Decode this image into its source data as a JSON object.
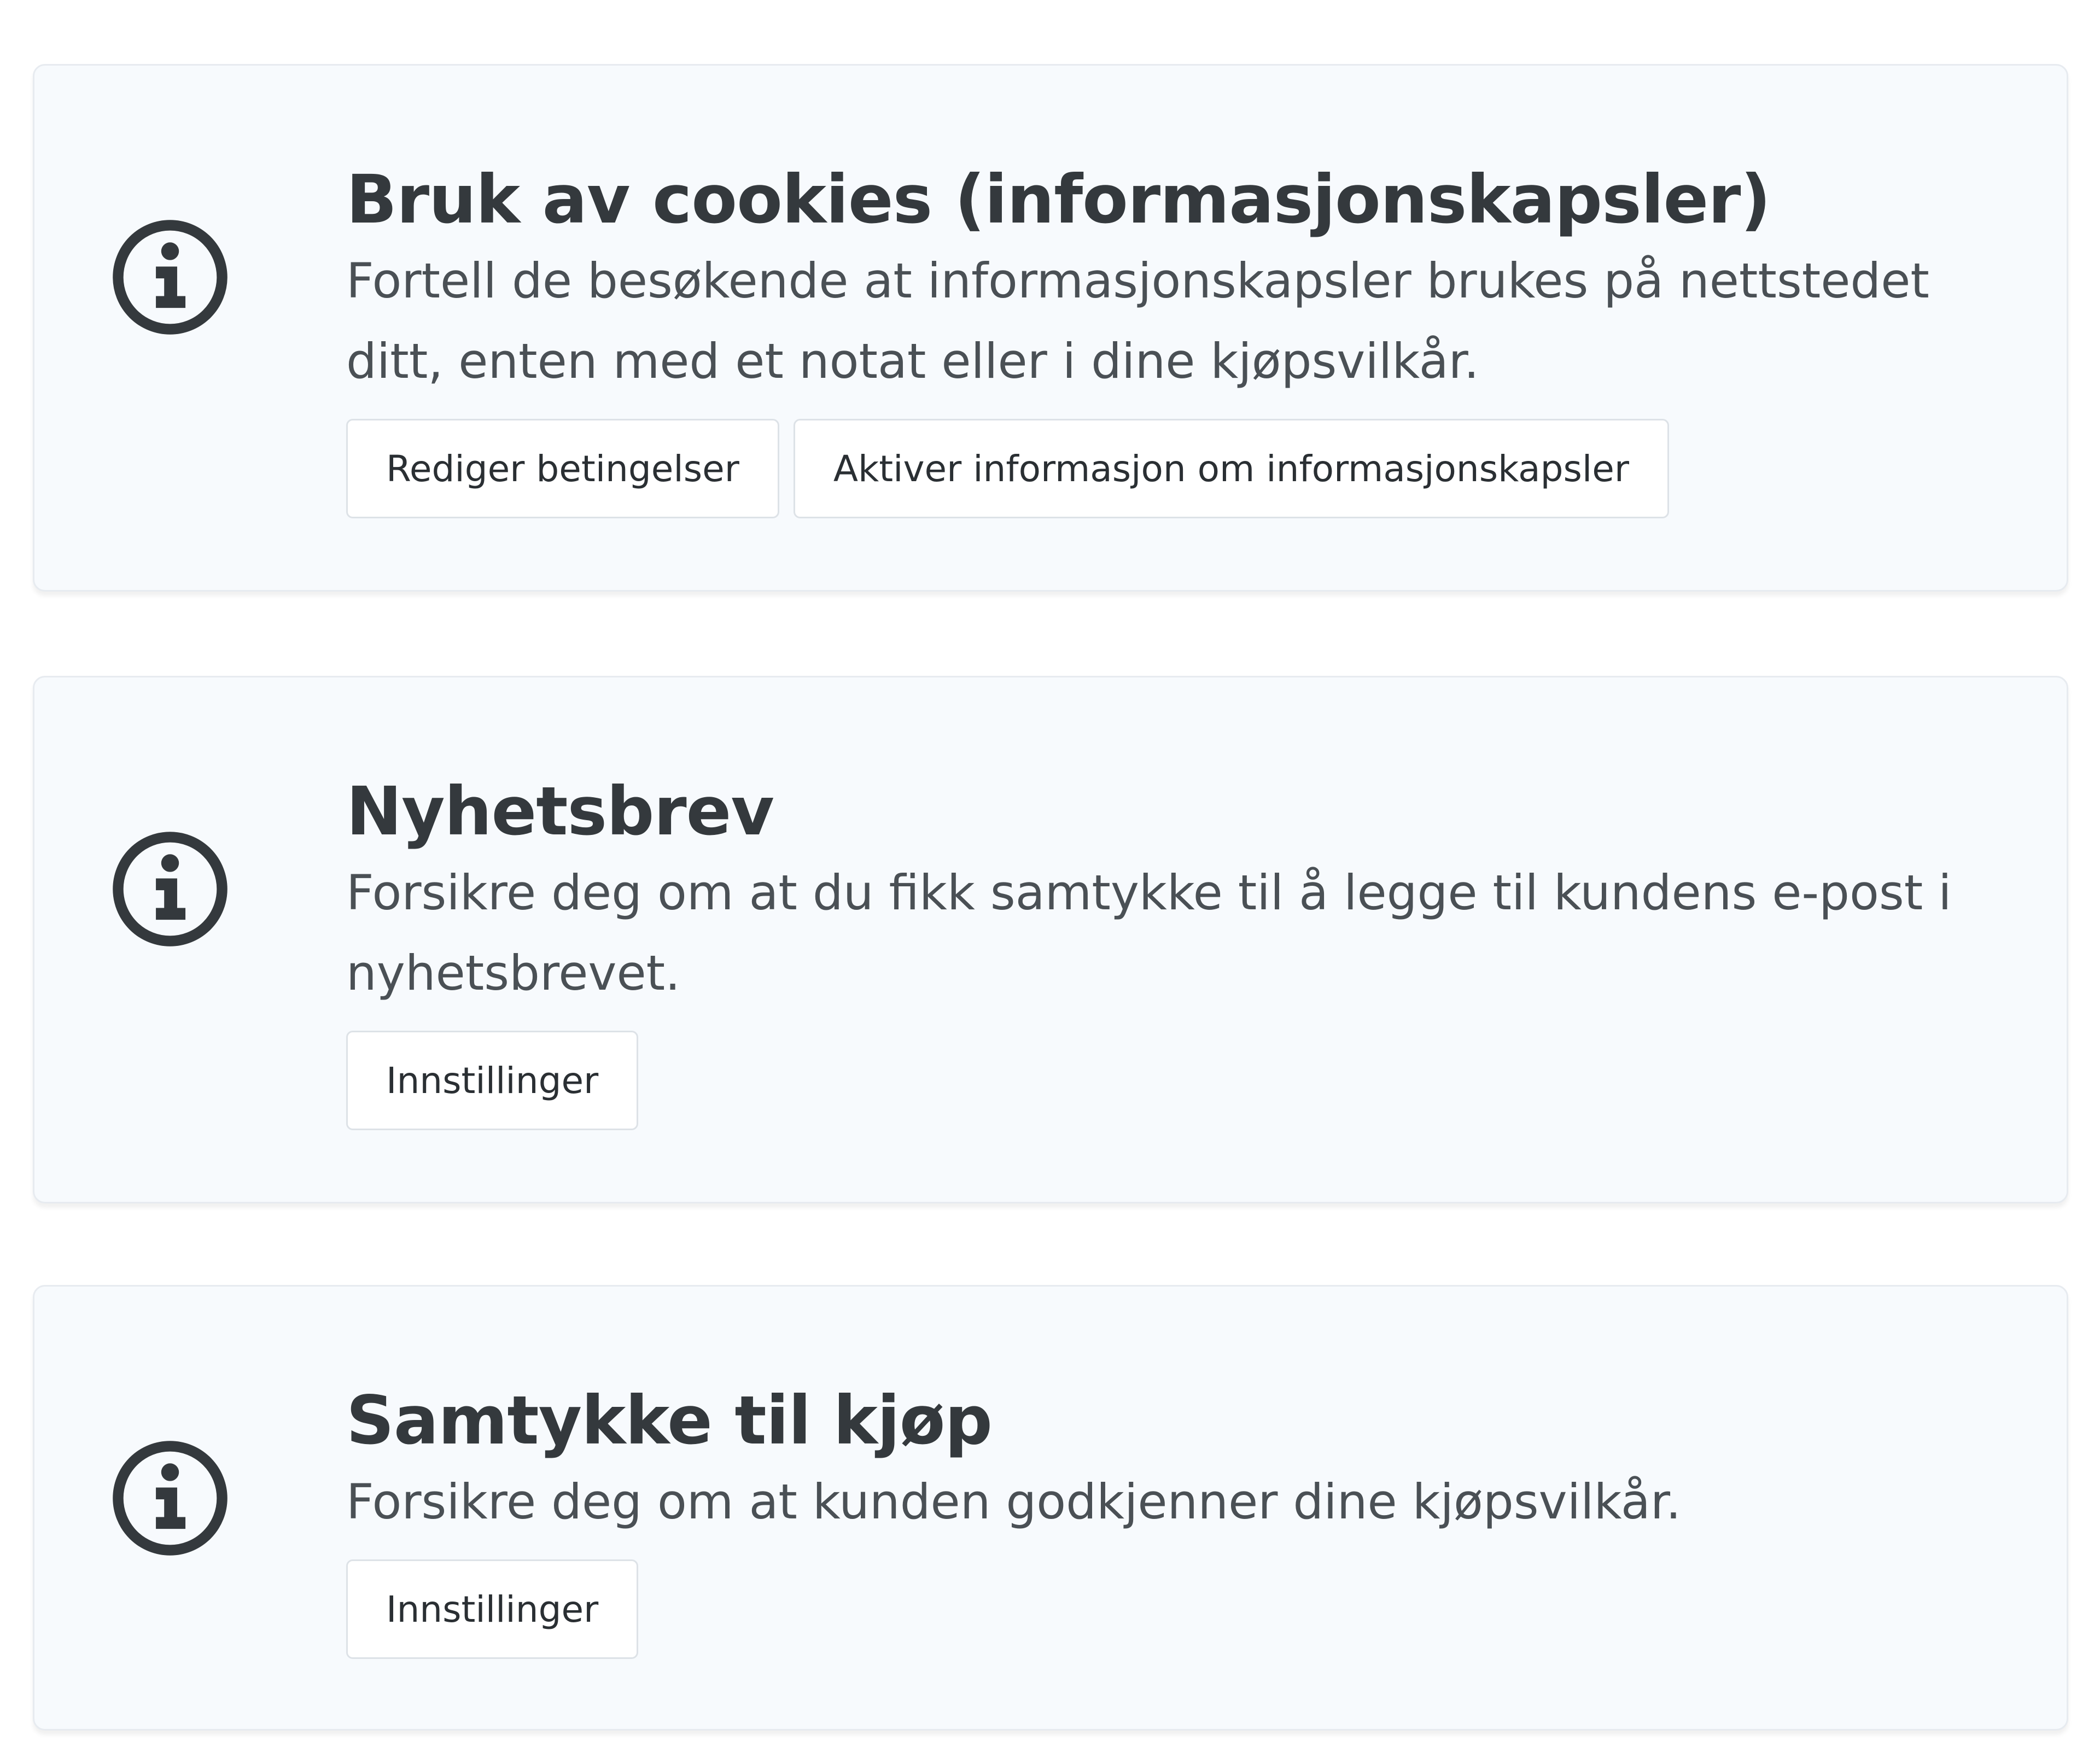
{
  "cards": [
    {
      "title": "Bruk av cookies (informasjonskapsler)",
      "description": "Fortell de besøkende at informasjonskapsler brukes på nettstedet ditt, enten med et notat eller i dine kjøpsvilkår.",
      "icon": "info-icon",
      "buttons": [
        {
          "label": "Rediger betingelser"
        },
        {
          "label": "Aktiver informasjon om informasjonskapsler"
        }
      ]
    },
    {
      "title": "Nyhetsbrev",
      "description": "Forsikre deg om at du fikk samtykke til å legge til kundens e-post i nyhetsbrevet.",
      "icon": "info-icon",
      "buttons": [
        {
          "label": "Innstillinger"
        }
      ]
    },
    {
      "title": "Samtykke til kjøp",
      "description": "Forsikre deg om at kunden godkjenner dine kjøpsvilkår.",
      "icon": "info-icon",
      "buttons": [
        {
          "label": "Innstillinger"
        }
      ]
    }
  ],
  "colors": {
    "card_background": "#f7fafd",
    "card_border": "#e7ebf0",
    "text_primary": "#34393d",
    "button_background": "#ffffff"
  }
}
